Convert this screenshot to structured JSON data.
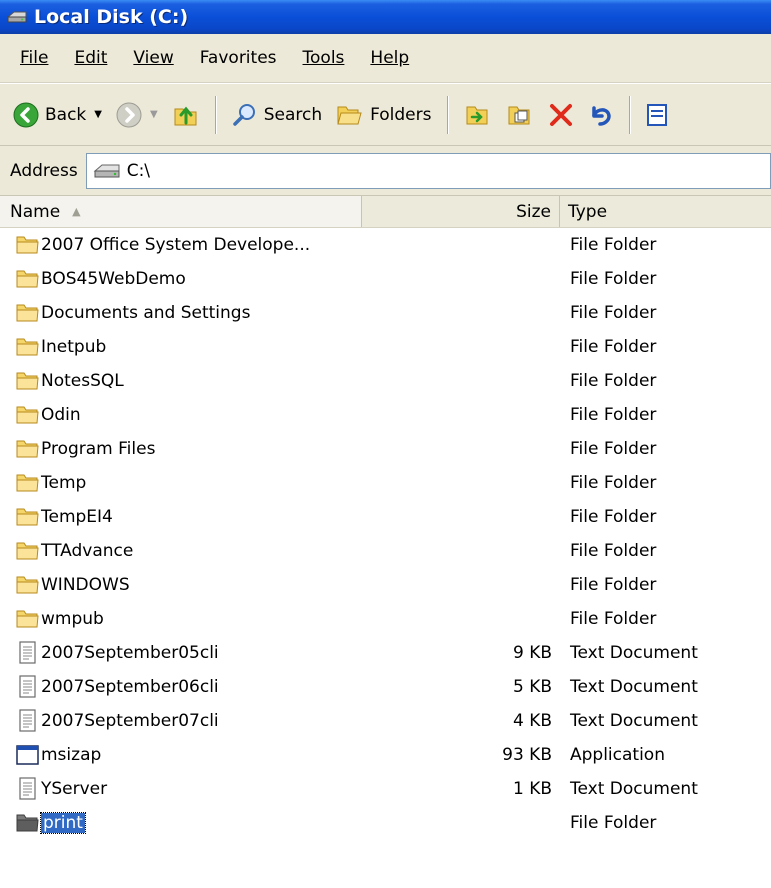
{
  "window": {
    "title": "Local Disk (C:)"
  },
  "menu": [
    {
      "label": "File"
    },
    {
      "label": "Edit"
    },
    {
      "label": "View"
    },
    {
      "label": "Favorites"
    },
    {
      "label": "Tools"
    },
    {
      "label": "Help"
    }
  ],
  "toolbar": {
    "back_label": "Back",
    "search_label": "Search",
    "folders_label": "Folders"
  },
  "address": {
    "label": "Address",
    "value": "C:\\"
  },
  "columns": {
    "name": "Name",
    "size": "Size",
    "type": "Type"
  },
  "files": [
    {
      "name": "2007 Office System Develope...",
      "size": "",
      "type": "File Folder",
      "icon": "folder-icon"
    },
    {
      "name": "BOS45WebDemo",
      "size": "",
      "type": "File Folder",
      "icon": "folder-icon"
    },
    {
      "name": "Documents and Settings",
      "size": "",
      "type": "File Folder",
      "icon": "folder-icon"
    },
    {
      "name": "Inetpub",
      "size": "",
      "type": "File Folder",
      "icon": "folder-icon"
    },
    {
      "name": "NotesSQL",
      "size": "",
      "type": "File Folder",
      "icon": "folder-icon"
    },
    {
      "name": "Odin",
      "size": "",
      "type": "File Folder",
      "icon": "folder-icon"
    },
    {
      "name": "Program Files",
      "size": "",
      "type": "File Folder",
      "icon": "folder-icon"
    },
    {
      "name": "Temp",
      "size": "",
      "type": "File Folder",
      "icon": "folder-icon"
    },
    {
      "name": "TempEI4",
      "size": "",
      "type": "File Folder",
      "icon": "folder-icon"
    },
    {
      "name": "TTAdvance",
      "size": "",
      "type": "File Folder",
      "icon": "folder-icon"
    },
    {
      "name": "WINDOWS",
      "size": "",
      "type": "File Folder",
      "icon": "folder-icon"
    },
    {
      "name": "wmpub",
      "size": "",
      "type": "File Folder",
      "icon": "folder-icon"
    },
    {
      "name": "2007September05cli",
      "size": "9 KB",
      "type": "Text Document",
      "icon": "text-document-icon"
    },
    {
      "name": "2007September06cli",
      "size": "5 KB",
      "type": "Text Document",
      "icon": "text-document-icon"
    },
    {
      "name": "2007September07cli",
      "size": "4 KB",
      "type": "Text Document",
      "icon": "text-document-icon"
    },
    {
      "name": "msizap",
      "size": "93 KB",
      "type": "Application",
      "icon": "application-icon"
    },
    {
      "name": "YServer",
      "size": "1 KB",
      "type": "Text Document",
      "icon": "text-document-icon"
    },
    {
      "name": "print",
      "size": "",
      "type": "File Folder",
      "icon": "folder-icon",
      "selected": true
    }
  ],
  "colors": {
    "title_bar": "#0a4fd8",
    "chrome": "#ece9d8",
    "selection": "#316ac5",
    "folder_yellow": "#f5d66a",
    "selected_folder": "#6e6e6e"
  }
}
